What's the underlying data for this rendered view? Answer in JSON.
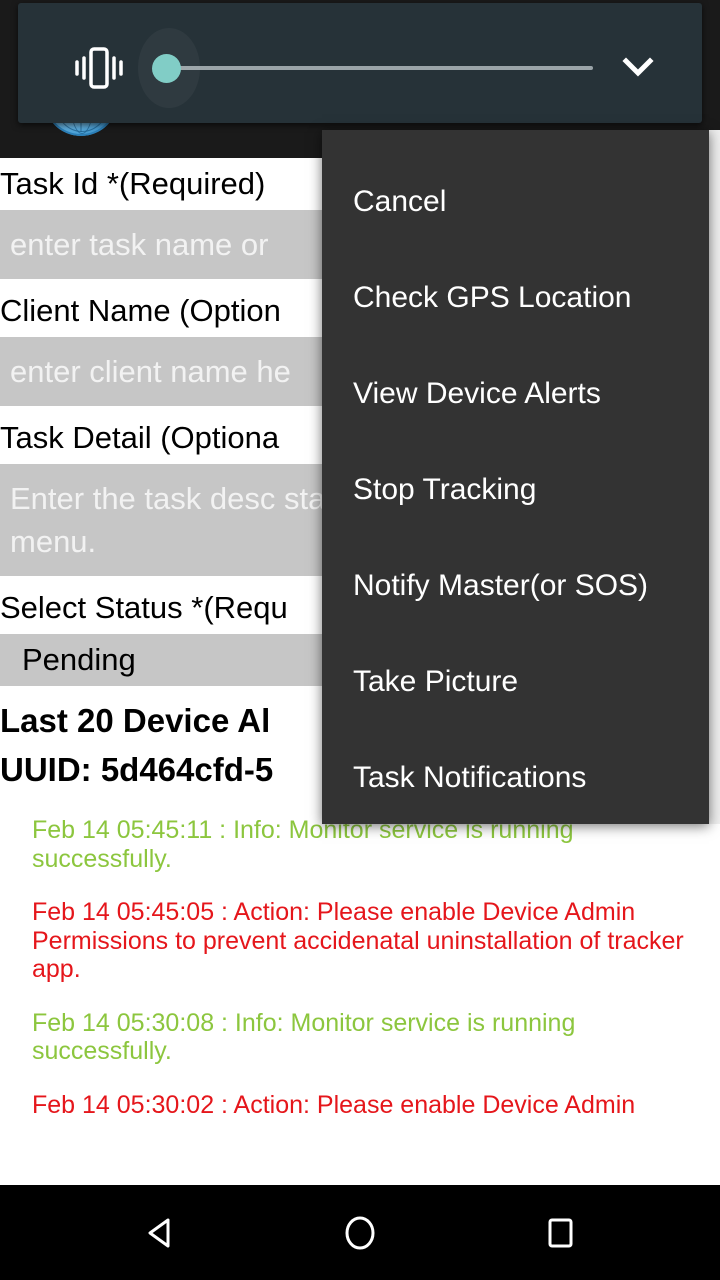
{
  "app": {
    "icon": "globe-icon"
  },
  "volume_panel": {
    "mode_icon": "vibrate-icon",
    "expand_icon": "chevron-down-icon",
    "slider_value": 0,
    "slider_min": 0,
    "slider_max": 100,
    "panel_color": "#263238",
    "thumb_color": "#81CDC6",
    "track_color": "#9AA4A8"
  },
  "form": {
    "fields": [
      {
        "label": "Task Id *(Required)",
        "placeholder": "enter task name or",
        "value": "",
        "type": "text",
        "name": "task-id"
      },
      {
        "label": "Client Name (Option",
        "placeholder": "enter client name he",
        "value": "",
        "type": "text",
        "name": "client-name"
      },
      {
        "label": "Task Detail (Optiona",
        "placeholder": "Enter the task desc status below and pr menu.",
        "value": "",
        "type": "textarea",
        "name": "task-detail"
      },
      {
        "label": "Select Status *(Requ",
        "value": "Pending",
        "type": "spinner",
        "name": "select-status"
      }
    ],
    "headings": [
      "Last 20 Device Al",
      "UUID: 5d464cfd-5"
    ]
  },
  "alerts": {
    "items": [
      {
        "text": "Feb 14 05:45:11 : Info: Monitor service is running successfully.",
        "level": "info"
      },
      {
        "text": "Feb 14 05:45:05 : Action: Please enable Device Admin Permissions to prevent accidenatal uninstallation of tracker app.",
        "level": "action"
      },
      {
        "text": "Feb 14 05:30:08 : Info: Monitor service is running successfully.",
        "level": "info"
      },
      {
        "text": "Feb 14 05:30:02 : Action: Please enable Device Admin",
        "level": "action"
      }
    ],
    "info_color": "#8CC63E",
    "action_color": "#E5161B"
  },
  "context_menu": {
    "background": "#333333",
    "items": [
      {
        "label": "Cancel",
        "name": "menu-item-cancel"
      },
      {
        "label": "Check GPS Location",
        "name": "menu-item-check-gps-location"
      },
      {
        "label": "View Device Alerts",
        "name": "menu-item-view-device-alerts"
      },
      {
        "label": "Stop Tracking",
        "name": "menu-item-stop-tracking"
      },
      {
        "label": "Notify Master(or SOS)",
        "name": "menu-item-notify-master"
      },
      {
        "label": "Take Picture",
        "name": "menu-item-take-picture"
      },
      {
        "label": "Task Notifications",
        "name": "menu-item-task-notifications"
      }
    ]
  },
  "navbar": {
    "back": "back-triangle-icon",
    "home": "home-circle-icon",
    "recents": "recents-square-icon"
  }
}
